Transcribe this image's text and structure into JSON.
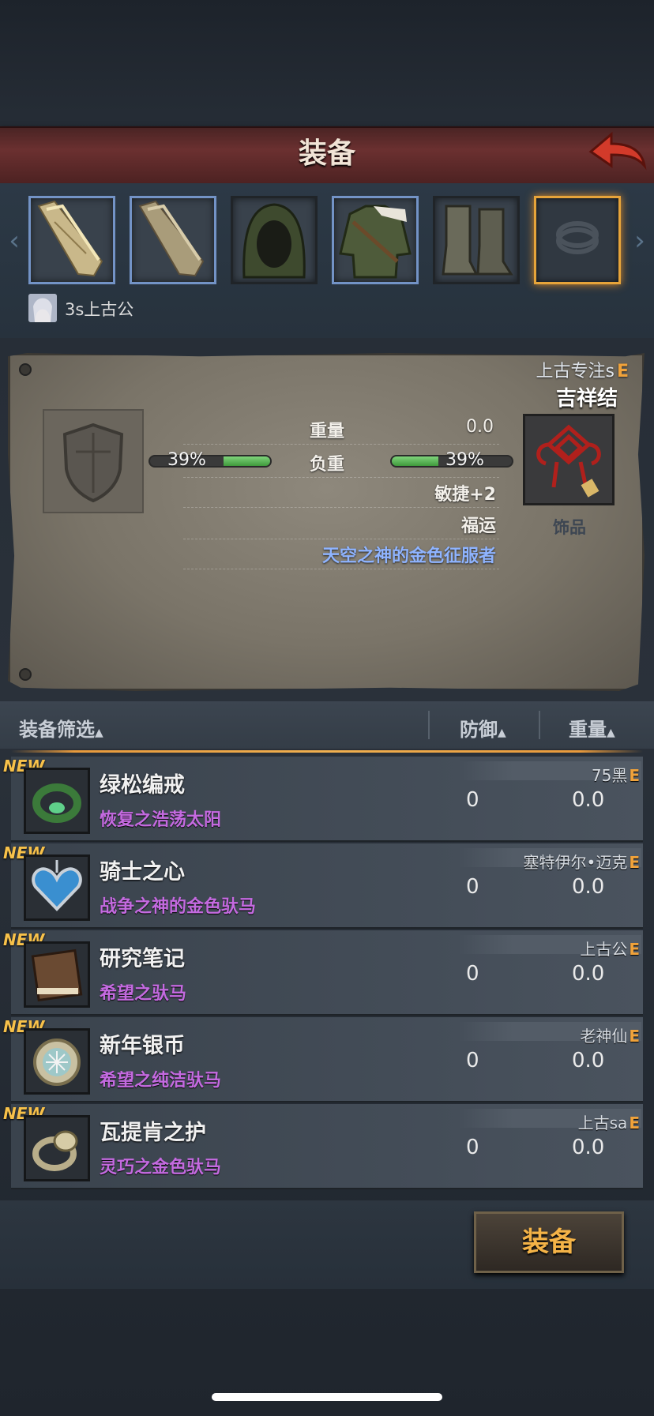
{
  "header": {
    "title": "装备"
  },
  "character": {
    "name": "3s上古公"
  },
  "slots": [
    {
      "name": "weapon-main-hand"
    },
    {
      "name": "weapon-off-hand"
    },
    {
      "name": "hood"
    },
    {
      "name": "chest-armor"
    },
    {
      "name": "boots"
    },
    {
      "name": "ring-empty"
    }
  ],
  "detail": {
    "owner": "上古专注s",
    "owner_grade": "E",
    "item_name": "吉祥结",
    "item_type": "饰品",
    "weight_label": "重量",
    "weight_value": "0.0",
    "load_label": "负重",
    "load_left_pct": "39%",
    "load_right_pct": "39%",
    "load_fraction": 0.39,
    "bonus": "敏捷+2",
    "fortune": "福运",
    "title_bonus": "天空之神的金色征服者"
  },
  "filter": {
    "filter_label": "装备筛选",
    "defense_label": "防御",
    "weight_label": "重量",
    "sort_arrow": "▲"
  },
  "items": [
    {
      "name": "绿松编戒",
      "sub": "恢复之浩荡太阳",
      "owner": "75黑",
      "grade": "E",
      "defense": "0",
      "weight": "0.0",
      "new": "NEW"
    },
    {
      "name": "骑士之心",
      "sub": "战争之神的金色驮马",
      "owner": "塞特伊尔•迈克",
      "grade": "E",
      "defense": "0",
      "weight": "0.0",
      "new": "NEW"
    },
    {
      "name": "研究笔记",
      "sub": "希望之驮马",
      "owner": "上古公",
      "grade": "E",
      "defense": "0",
      "weight": "0.0",
      "new": "NEW"
    },
    {
      "name": "新年银币",
      "sub": "希望之纯洁驮马",
      "owner": "老神仙",
      "grade": "E",
      "defense": "0",
      "weight": "0.0",
      "new": "NEW"
    },
    {
      "name": "瓦提肯之护",
      "sub": "灵巧之金色驮马",
      "owner": "上古sa",
      "grade": "E",
      "defense": "0",
      "weight": "0.0",
      "new": "NEW"
    }
  ],
  "actions": {
    "equip_label": "装备"
  },
  "colors": {
    "accent_orange": "#f0a23a",
    "purple_sub": "#c46ae0",
    "header_red": "#6b3030"
  }
}
